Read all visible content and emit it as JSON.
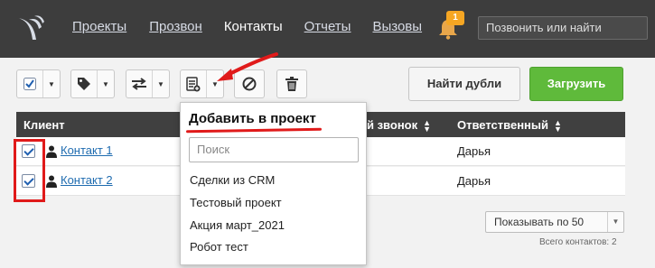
{
  "nav": {
    "items": [
      "Проекты",
      "Прозвон",
      "Контакты",
      "Отчеты",
      "Вызовы"
    ],
    "active": "Контакты"
  },
  "notifications": {
    "count": "1"
  },
  "search": {
    "placeholder": "Позвонить или найти"
  },
  "actions": {
    "find_duplicates": "Найти дубли",
    "load": "Загрузить"
  },
  "table": {
    "columns": {
      "client": "Клиент",
      "last_call": "ий звонок",
      "responsible": "Ответственный"
    },
    "rows": [
      {
        "name": "Контакт 1",
        "responsible": "Дарья",
        "checked": true
      },
      {
        "name": "Контакт 2",
        "responsible": "Дарья",
        "checked": true
      }
    ]
  },
  "popup": {
    "title": "Добавить в проект",
    "search_placeholder": "Поиск",
    "items": [
      "Сделки из CRM",
      "Тестовый проект",
      "Акция март_2021",
      "Робот тест"
    ]
  },
  "pager": {
    "label": "Показывать по 50"
  },
  "total": "Всего контактов: 2",
  "colors": {
    "accent_green": "#5fba3b",
    "link": "#1f6cb0",
    "highlight_red": "#e01a1a",
    "header_bg": "#3d3d3d"
  }
}
